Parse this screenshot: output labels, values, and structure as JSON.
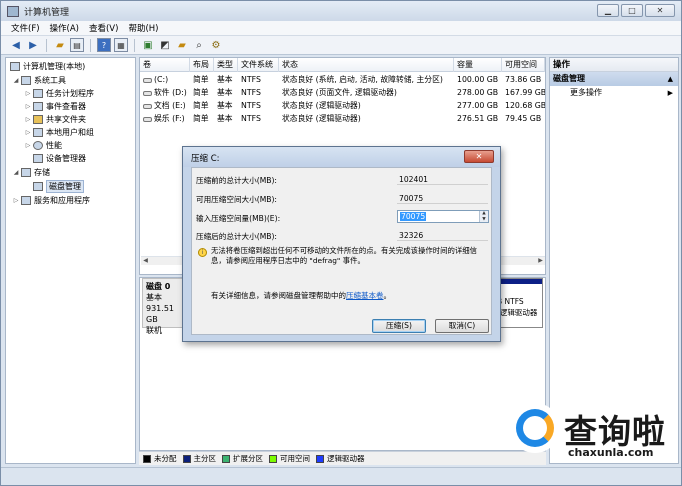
{
  "window": {
    "title": "计算机管理"
  },
  "menu": [
    "文件(F)",
    "操作(A)",
    "查看(V)",
    "帮助(H)"
  ],
  "toolbar": {
    "icons": [
      "back-arrow-icon",
      "forward-arrow-icon",
      "up-folder-icon",
      "show-hide-tree-icon",
      "help-icon",
      "properties-icon",
      "export-icon",
      "connect-icon",
      "open-icon",
      "search-icon",
      "settings-icon"
    ]
  },
  "tree": {
    "root": "计算机管理(本地)",
    "items": [
      {
        "label": "系统工具",
        "level": 1,
        "expander": "◢"
      },
      {
        "label": "任务计划程序",
        "level": 2,
        "expander": "▷"
      },
      {
        "label": "事件查看器",
        "level": 2,
        "expander": "▷"
      },
      {
        "label": "共享文件夹",
        "level": 2,
        "expander": "▷"
      },
      {
        "label": "本地用户和组",
        "level": 2,
        "expander": "▷"
      },
      {
        "label": "性能",
        "level": 2,
        "expander": "▷"
      },
      {
        "label": "设备管理器",
        "level": 2,
        "expander": ""
      },
      {
        "label": "存储",
        "level": 1,
        "expander": "◢"
      },
      {
        "label": "磁盘管理",
        "level": 2,
        "expander": "",
        "selected": true
      },
      {
        "label": "服务和应用程序",
        "level": 1,
        "expander": "▷"
      }
    ]
  },
  "volumes": {
    "columns": [
      "卷",
      "布局",
      "类型",
      "文件系统",
      "状态",
      "容量",
      "可用空间"
    ],
    "rows": [
      [
        "(C:)",
        "简单",
        "基本",
        "NTFS",
        "状态良好 (系统, 启动, 活动, 故障转储, 主分区)",
        "100.00 GB",
        "73.86 GB"
      ],
      [
        "软件 (D:)",
        "简单",
        "基本",
        "NTFS",
        "状态良好 (页面文件, 逻辑驱动器)",
        "278.00 GB",
        "167.99 GB"
      ],
      [
        "文档 (E:)",
        "简单",
        "基本",
        "NTFS",
        "状态良好 (逻辑驱动器)",
        "277.00 GB",
        "120.68 GB"
      ],
      [
        "娱乐 (F:)",
        "简单",
        "基本",
        "NTFS",
        "状态良好 (逻辑驱动器)",
        "276.51 GB",
        "79.45 GB"
      ]
    ]
  },
  "disk": {
    "title": "磁盘 0",
    "type": "基本",
    "size": "931.51 GB",
    "status": "联机",
    "partition_fs": "B NTFS",
    "partition_status": "(逻辑驱动器"
  },
  "legend": [
    {
      "label": "未分配",
      "color": "#000000"
    },
    {
      "label": "主分区",
      "color": "#0a1f7a"
    },
    {
      "label": "扩展分区",
      "color": "#3cb371"
    },
    {
      "label": "可用空间",
      "color": "#7cfc00"
    },
    {
      "label": "逻辑驱动器",
      "color": "#1e3cff"
    }
  ],
  "actions": {
    "title": "操作",
    "section": "磁盘管理",
    "more": "更多操作"
  },
  "dialog": {
    "title": "压缩 C:",
    "fields": [
      {
        "label": "压缩前的总计大小(MB):",
        "value": "102401"
      },
      {
        "label": "可用压缩空间大小(MB):",
        "value": "70075"
      },
      {
        "label": "输入压缩空间量(MB)(E):",
        "value": "70075"
      },
      {
        "label": "压缩后的总计大小(MB):",
        "value": "32326"
      }
    ],
    "note": "无法将卷压缩到超出任何不可移动的文件所在的点。有关完成该操作时间的详细信息，请参阅应用程序日志中的 \"defrag\" 事件。",
    "help_prefix": "有关详细信息，请参阅磁盘管理帮助中的",
    "help_link": "压缩基本卷",
    "help_suffix": "。",
    "ok_label": "压缩(S)",
    "cancel_label": "取消(C)"
  },
  "watermark": {
    "brand": "查询啦",
    "url": "chaxunla.com"
  }
}
